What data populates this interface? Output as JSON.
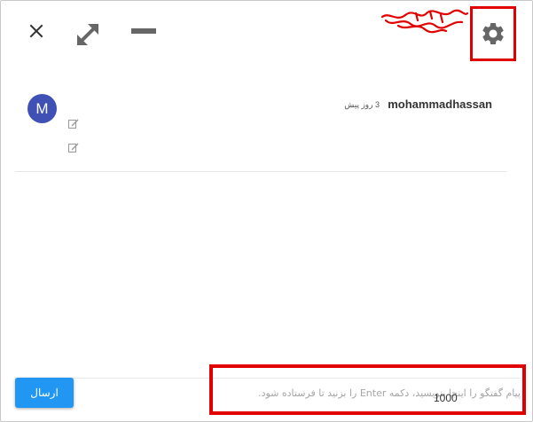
{
  "toolbar": {
    "close_icon": "close-icon",
    "expand_icon": "expand-icon",
    "minimize_icon": "minimize-icon",
    "settings_icon": "gear-icon",
    "highlight_color": "#e00000"
  },
  "message": {
    "avatar_letter": "M",
    "avatar_color": "#3f51b5",
    "author": "mohammadhassan",
    "time": "3 روز پیش",
    "actions": [
      "edit-icon",
      "edit-icon"
    ]
  },
  "composer": {
    "send_label": "ارسال",
    "send_color": "#2196f3",
    "input_placeholder": "پیام گفتگو را اینجا بنویسید، دکمه Enter را بزنید تا فرستاده شود.",
    "char_count": "1000"
  }
}
